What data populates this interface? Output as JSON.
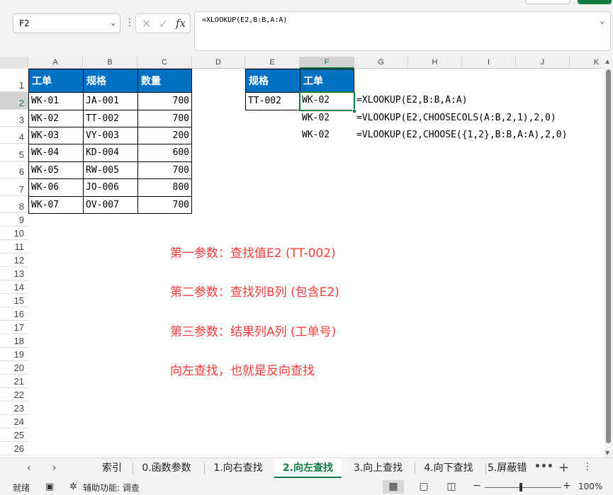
{
  "formula_bar": {
    "name_box": "F2",
    "formula": "=XLOOKUP(E2,B:B,A:A)"
  },
  "columns": [
    "A",
    "B",
    "C",
    "D",
    "E",
    "F",
    "G",
    "H",
    "I",
    "J",
    "K"
  ],
  "rows": [
    "1",
    "2",
    "3",
    "4",
    "5",
    "6",
    "7",
    "8",
    "9",
    "10",
    "11",
    "12",
    "13",
    "14",
    "15",
    "16",
    "17",
    "18",
    "19",
    "20",
    "21",
    "22",
    "23",
    "24",
    "25",
    "26"
  ],
  "table_left": {
    "headers": [
      "工单",
      "规格",
      "数量"
    ],
    "rows": [
      [
        "WK-01",
        "JA-001",
        "700"
      ],
      [
        "WK-02",
        "TT-002",
        "700"
      ],
      [
        "WK-03",
        "VY-003",
        "200"
      ],
      [
        "WK-04",
        "KD-004",
        "600"
      ],
      [
        "WK-05",
        "RW-005",
        "700"
      ],
      [
        "WK-06",
        "JO-006",
        "800"
      ],
      [
        "WK-07",
        "OV-007",
        "700"
      ]
    ]
  },
  "table_right": {
    "headers": [
      "规格",
      "工单"
    ],
    "input": "TT-002",
    "results": [
      "WK-02",
      "WK-02",
      "WK-02"
    ],
    "formulas": [
      "=XLOOKUP(E2,B:B,A:A)",
      "=VLOOKUP(E2,CHOOSECOLS(A:B,2,1),2,0)",
      "=VLOOKUP(E2,CHOOSE({1,2},B:B,A:A),2,0)"
    ]
  },
  "annotations": [
    "第一参数：查找值E2 (TT-002)",
    "第二参数：查找列B列 (包含E2)",
    "第三参数：结果列A列  (工单号)",
    "向左查找，也就是反向查找"
  ],
  "sheet_tabs": [
    "索引",
    "0.函数参数",
    "1.向右查找",
    "2.向左查找",
    "3.向上查找",
    "4.向下查找",
    "5.屏蔽错"
  ],
  "active_tab": "2.向左查找",
  "status": {
    "ready": "就绪",
    "accessibility": "辅助功能: 调查",
    "zoom": "100%"
  },
  "colors": {
    "accent": "#107c41",
    "header_fill": "#0070c0",
    "annotation": "#ff3b3b"
  }
}
